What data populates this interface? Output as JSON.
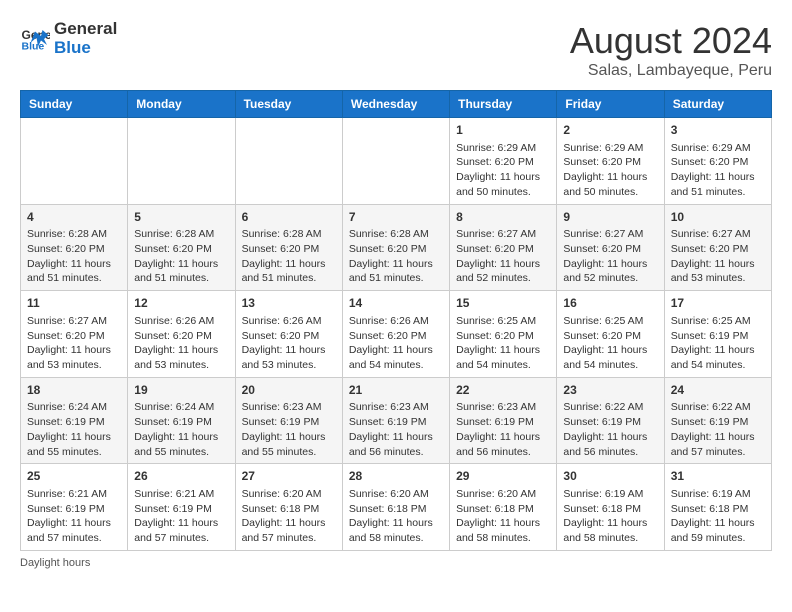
{
  "logo": {
    "line1": "General",
    "line2": "Blue"
  },
  "title": "August 2024",
  "subtitle": "Salas, Lambayeque, Peru",
  "header_days": [
    "Sunday",
    "Monday",
    "Tuesday",
    "Wednesday",
    "Thursday",
    "Friday",
    "Saturday"
  ],
  "weeks": [
    [
      {
        "day": "",
        "info": ""
      },
      {
        "day": "",
        "info": ""
      },
      {
        "day": "",
        "info": ""
      },
      {
        "day": "",
        "info": ""
      },
      {
        "day": "1",
        "info": "Sunrise: 6:29 AM\nSunset: 6:20 PM\nDaylight: 11 hours and 50 minutes."
      },
      {
        "day": "2",
        "info": "Sunrise: 6:29 AM\nSunset: 6:20 PM\nDaylight: 11 hours and 50 minutes."
      },
      {
        "day": "3",
        "info": "Sunrise: 6:29 AM\nSunset: 6:20 PM\nDaylight: 11 hours and 51 minutes."
      }
    ],
    [
      {
        "day": "4",
        "info": "Sunrise: 6:28 AM\nSunset: 6:20 PM\nDaylight: 11 hours and 51 minutes."
      },
      {
        "day": "5",
        "info": "Sunrise: 6:28 AM\nSunset: 6:20 PM\nDaylight: 11 hours and 51 minutes."
      },
      {
        "day": "6",
        "info": "Sunrise: 6:28 AM\nSunset: 6:20 PM\nDaylight: 11 hours and 51 minutes."
      },
      {
        "day": "7",
        "info": "Sunrise: 6:28 AM\nSunset: 6:20 PM\nDaylight: 11 hours and 51 minutes."
      },
      {
        "day": "8",
        "info": "Sunrise: 6:27 AM\nSunset: 6:20 PM\nDaylight: 11 hours and 52 minutes."
      },
      {
        "day": "9",
        "info": "Sunrise: 6:27 AM\nSunset: 6:20 PM\nDaylight: 11 hours and 52 minutes."
      },
      {
        "day": "10",
        "info": "Sunrise: 6:27 AM\nSunset: 6:20 PM\nDaylight: 11 hours and 53 minutes."
      }
    ],
    [
      {
        "day": "11",
        "info": "Sunrise: 6:27 AM\nSunset: 6:20 PM\nDaylight: 11 hours and 53 minutes."
      },
      {
        "day": "12",
        "info": "Sunrise: 6:26 AM\nSunset: 6:20 PM\nDaylight: 11 hours and 53 minutes."
      },
      {
        "day": "13",
        "info": "Sunrise: 6:26 AM\nSunset: 6:20 PM\nDaylight: 11 hours and 53 minutes."
      },
      {
        "day": "14",
        "info": "Sunrise: 6:26 AM\nSunset: 6:20 PM\nDaylight: 11 hours and 54 minutes."
      },
      {
        "day": "15",
        "info": "Sunrise: 6:25 AM\nSunset: 6:20 PM\nDaylight: 11 hours and 54 minutes."
      },
      {
        "day": "16",
        "info": "Sunrise: 6:25 AM\nSunset: 6:20 PM\nDaylight: 11 hours and 54 minutes."
      },
      {
        "day": "17",
        "info": "Sunrise: 6:25 AM\nSunset: 6:19 PM\nDaylight: 11 hours and 54 minutes."
      }
    ],
    [
      {
        "day": "18",
        "info": "Sunrise: 6:24 AM\nSunset: 6:19 PM\nDaylight: 11 hours and 55 minutes."
      },
      {
        "day": "19",
        "info": "Sunrise: 6:24 AM\nSunset: 6:19 PM\nDaylight: 11 hours and 55 minutes."
      },
      {
        "day": "20",
        "info": "Sunrise: 6:23 AM\nSunset: 6:19 PM\nDaylight: 11 hours and 55 minutes."
      },
      {
        "day": "21",
        "info": "Sunrise: 6:23 AM\nSunset: 6:19 PM\nDaylight: 11 hours and 56 minutes."
      },
      {
        "day": "22",
        "info": "Sunrise: 6:23 AM\nSunset: 6:19 PM\nDaylight: 11 hours and 56 minutes."
      },
      {
        "day": "23",
        "info": "Sunrise: 6:22 AM\nSunset: 6:19 PM\nDaylight: 11 hours and 56 minutes."
      },
      {
        "day": "24",
        "info": "Sunrise: 6:22 AM\nSunset: 6:19 PM\nDaylight: 11 hours and 57 minutes."
      }
    ],
    [
      {
        "day": "25",
        "info": "Sunrise: 6:21 AM\nSunset: 6:19 PM\nDaylight: 11 hours and 57 minutes."
      },
      {
        "day": "26",
        "info": "Sunrise: 6:21 AM\nSunset: 6:19 PM\nDaylight: 11 hours and 57 minutes."
      },
      {
        "day": "27",
        "info": "Sunrise: 6:20 AM\nSunset: 6:18 PM\nDaylight: 11 hours and 57 minutes."
      },
      {
        "day": "28",
        "info": "Sunrise: 6:20 AM\nSunset: 6:18 PM\nDaylight: 11 hours and 58 minutes."
      },
      {
        "day": "29",
        "info": "Sunrise: 6:20 AM\nSunset: 6:18 PM\nDaylight: 11 hours and 58 minutes."
      },
      {
        "day": "30",
        "info": "Sunrise: 6:19 AM\nSunset: 6:18 PM\nDaylight: 11 hours and 58 minutes."
      },
      {
        "day": "31",
        "info": "Sunrise: 6:19 AM\nSunset: 6:18 PM\nDaylight: 11 hours and 59 minutes."
      }
    ]
  ],
  "footnote": "Daylight hours"
}
